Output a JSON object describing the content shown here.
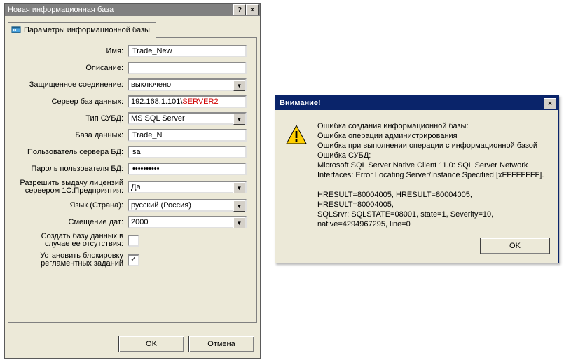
{
  "main": {
    "title": "Новая информационная база",
    "tab_label": "Параметры информационной базы",
    "labels": {
      "name": "Имя:",
      "description": "Описание:",
      "secure_conn": "Защищенное соединение:",
      "db_server": "Сервер баз данных:",
      "dbms_type": "Тип СУБД:",
      "database": "База данных:",
      "db_user": "Пользователь сервера БД:",
      "db_password": "Пароль пользователя БД:",
      "allow_lic_line1": "Разрешить выдачу лицензий",
      "allow_lic_line2": "сервером 1С:Предприятия:",
      "language": "Язык (Страна):",
      "date_offset": "Смещение дат:",
      "create_db_line1": "Создать базу данных в",
      "create_db_line2": "случае ее отсутствия:",
      "block_jobs_line1": "Установить блокировку",
      "block_jobs_line2": "регламентных заданий"
    },
    "values": {
      "name": "Trade_New",
      "description": "",
      "secure_conn": "выключено",
      "db_server_prefix": "192.168.1.101\\",
      "db_server_red": "SERVER2",
      "dbms_type": "MS SQL Server",
      "database": "Trade_N",
      "db_user": "sa",
      "db_password_mask": "**********",
      "allow_lic": "Да",
      "language": "русский (Россия)",
      "date_offset": "2000",
      "create_db_checked": false,
      "block_jobs_checked": true
    },
    "buttons": {
      "ok": "OK",
      "cancel": "Отмена"
    }
  },
  "error": {
    "title": "Внимание!",
    "lines_block1": [
      "Ошибка создания информационной базы:",
      "Ошибка операции администрирования",
      "Ошибка при выполнении операции с информационной базой",
      "Ошибка СУБД:",
      "Microsoft SQL Server Native Client 11.0: SQL Server Network",
      "Interfaces: Error Locating Server/Instance Specified [xFFFFFFFF]."
    ],
    "lines_block2": [
      "HRESULT=80004005, HRESULT=80004005, HRESULT=80004005,",
      "SQLSrvr: SQLSTATE=08001, state=1, Severity=10,",
      "native=4294967295, line=0"
    ],
    "ok": "OK"
  }
}
